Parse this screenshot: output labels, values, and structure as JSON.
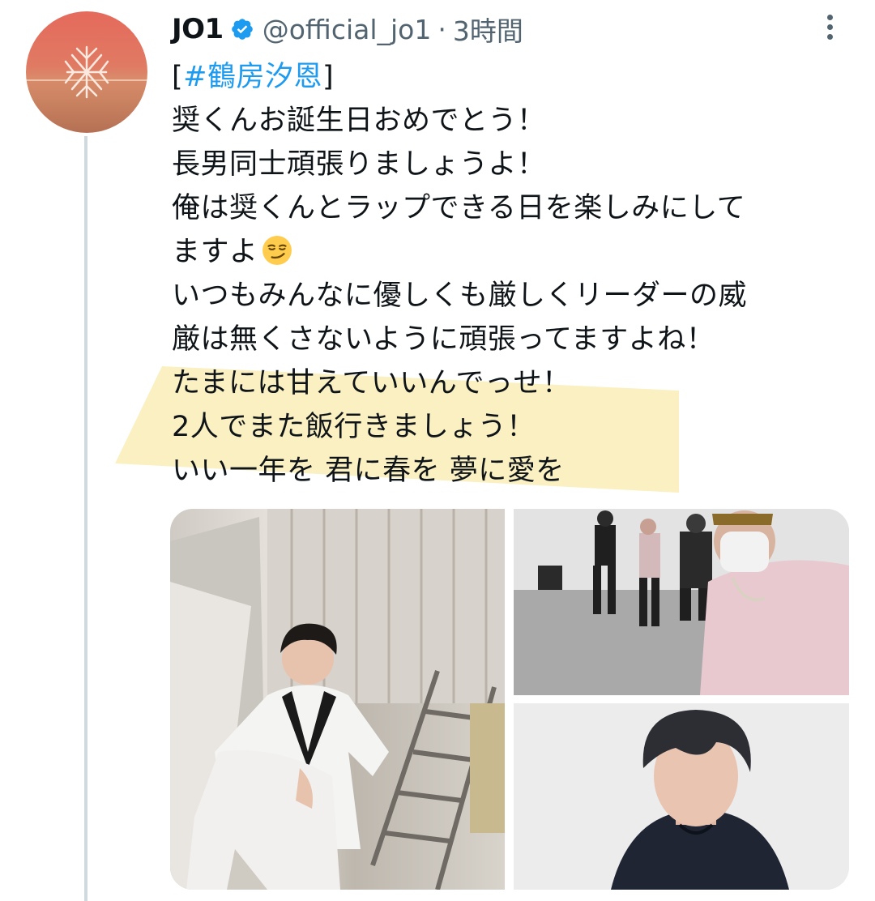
{
  "tweet": {
    "author_name": "JO1",
    "handle": "@official_jo1",
    "separator": "·",
    "time": "3時間",
    "hashtag_open": "[",
    "hashtag": "#鶴房汐恩",
    "hashtag_close": "]",
    "lines": [
      "奨くんお誕生日おめでとう！",
      "長男同士頑張りましょうよ！",
      "俺は奨くんとラップできる日を楽しみにして",
      "ますよ",
      "いつもみんなに優しくも厳しくリーダーの威",
      "厳は無くさないように頑張ってますよね！",
      "たまには甘えていいんでっせ！",
      "2人でまた飯行きましょう！",
      "いい一年を 君に春を 夢に愛を"
    ],
    "emoji": "smirking-face-emoji"
  },
  "colors": {
    "link": "#1d9bf0",
    "verified": "#1d9bf0",
    "secondary_text": "#536471",
    "highlight": "#faeebb",
    "thread_line": "#cfd9de"
  },
  "media": {
    "photos": [
      "person-in-white-outfit-on-stairs",
      "dance-practice-room-selfie",
      "person-in-black-hoodie-selfie"
    ]
  }
}
